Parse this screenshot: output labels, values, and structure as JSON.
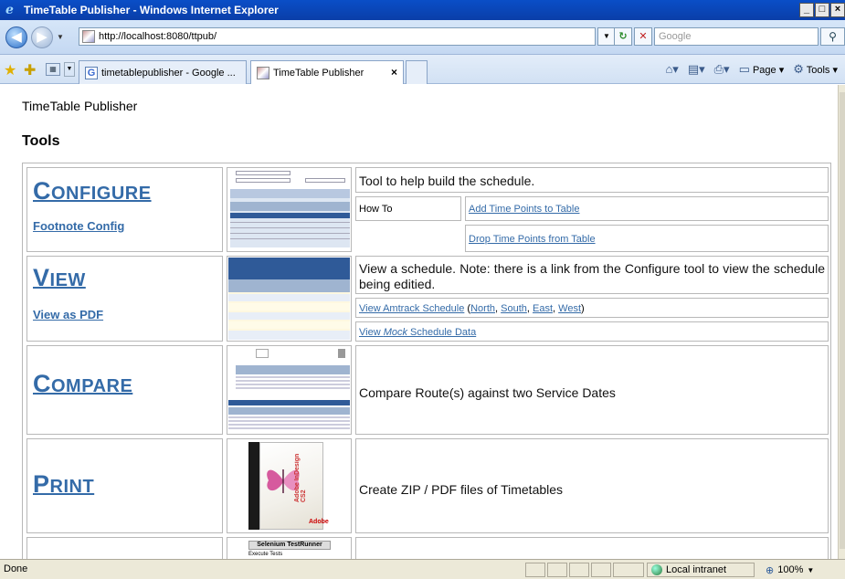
{
  "window": {
    "title": "TimeTable Publisher - Windows Internet Explorer",
    "buttons": [
      "_",
      "□",
      "×"
    ]
  },
  "address": {
    "url": "http://localhost:8080/ttpub/",
    "search_placeholder": "Google"
  },
  "tabs": [
    {
      "label": "timetablepublisher - Google ..."
    },
    {
      "label": "TimeTable Publisher"
    }
  ],
  "commands": {
    "page": "Page",
    "tools": "Tools"
  },
  "page": {
    "app_title": "TimeTable Publisher",
    "section_title": "Tools",
    "configure": {
      "title_cap": "C",
      "title_rest": "ONFIGURE",
      "sublink": "Footnote Config",
      "desc": "Tool to help build the schedule.",
      "howto_label": "How To",
      "howto_links": [
        "Add Time Points to Table",
        "Drop Time Points from Table"
      ],
      "thumb_headers": [
        "Beaverton",
        "Hillsboro",
        "Orenco",
        "Quatama",
        "Sunset",
        "TC"
      ]
    },
    "view": {
      "title_cap": "V",
      "title_rest": "IEW",
      "sublink": "View as PDF",
      "desc": "View a schedule. Note: there is a link from the Configure tool to view the schedule being editied.",
      "amtrack_link": "View Amtrack Schedule",
      "amtrack_open": "(",
      "dirs": [
        "North",
        "South",
        "East",
        "West"
      ],
      "amtrack_close": ")",
      "mock_pre": "View ",
      "mock_em": "Mock",
      "mock_post": " Schedule Data",
      "thumb_headers": [
        "Eugene Amtrak",
        "Salem Amtrak",
        "Portland OR Amtrak",
        "Tacoma Amtrak",
        "Seattle King Street Amtrak Station",
        "Everett Amtrak"
      ]
    },
    "compare": {
      "title_cap": "C",
      "title_rest": "OMPARE",
      "desc": "Compare Route(s) against two Service Dates",
      "thumb_headers": [
        "Route",
        "Timepoint Diff",
        "Sto"
      ]
    },
    "print": {
      "title_cap": "P",
      "title_rest": "RINT",
      "desc": "Create ZIP / PDF files of Timetables",
      "box_brand": "Adobe InDesign CS2",
      "box_logo": "Adobe"
    },
    "selenium": {
      "thumb_title": "Selenium TestRunner",
      "thumb_sub": "Execute Tests"
    }
  },
  "status": {
    "text": "Done",
    "zone": "Local intranet",
    "zoom": "100%"
  },
  "colors": {
    "link": "#346ba8",
    "titlebar": "#0a4ec7"
  }
}
